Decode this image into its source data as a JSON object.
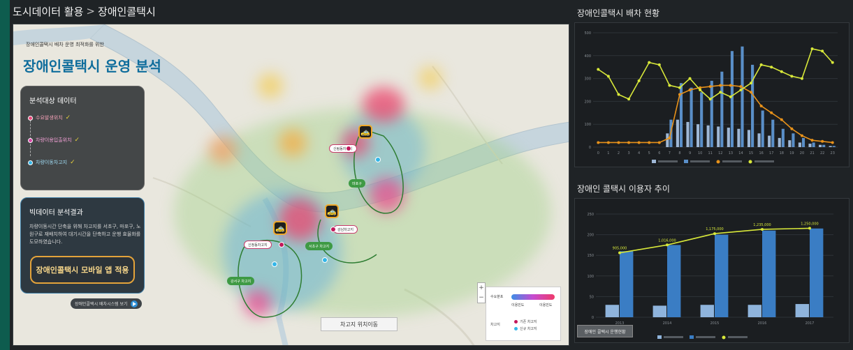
{
  "breadcrumb": {
    "parent": "도시데이터 활용",
    "separator": ">",
    "current": "장애인콜택시"
  },
  "intro": {
    "subtitle": "장애인콜택시 배차 운영 최적화를 위한",
    "title": "장애인콜택시 운영 분석"
  },
  "analysis_panel": {
    "title": "분석대상 데이터",
    "items": [
      {
        "label": "수요발생위치",
        "color": "#e84a7a"
      },
      {
        "label": "차량이용입출위치",
        "color": "#d946a8"
      },
      {
        "label": "차량이동차고지",
        "color": "#33b6e8"
      }
    ],
    "check_mark": "✓"
  },
  "result_panel": {
    "title": "빅데이터 분석결과",
    "body": "차량이동시간 단축을 위해 차고지를 서초구, 마포구, 노원구로 재배치하여 대기시간을 단축하고 운행 효율화를 도모하였습니다."
  },
  "app_button": "장애인콜택시 모바일 앱 적용",
  "play_button": "장애인콜택시 배차시스템 보기",
  "map": {
    "pins": [
      {
        "label": "신림동차고지"
      },
      {
        "label": "강남차고지"
      },
      {
        "label": "신정동차고지"
      }
    ],
    "green_tags": [
      "마포구",
      "서초구 차고지",
      "강서구 차고지"
    ],
    "legend": {
      "title": "수요분포",
      "low": "이용빈도",
      "high": "이용빈도",
      "sub_title": "차고지",
      "items": [
        "기존 차고지",
        "신규 차고지"
      ]
    },
    "garage_button": "차고지 위치이동",
    "zoom_in": "+",
    "zoom_out": "−"
  },
  "dispatch_chart": {
    "title": "장애인콜택시 배차 현황",
    "chart_data": {
      "type": "bar",
      "categories": [
        "0",
        "1",
        "2",
        "3",
        "4",
        "5",
        "6",
        "7",
        "8",
        "9",
        "10",
        "11",
        "12",
        "13",
        "14",
        "15",
        "16",
        "17",
        "18",
        "19",
        "20",
        "21",
        "22",
        "23"
      ],
      "series": [
        {
          "name": "",
          "kind": "bar",
          "color": "#9fb8d6",
          "values": [
            0,
            0,
            0,
            0,
            0,
            0,
            0,
            60,
            120,
            110,
            100,
            95,
            90,
            85,
            80,
            75,
            60,
            50,
            40,
            30,
            20,
            15,
            10,
            5
          ]
        },
        {
          "name": "",
          "kind": "bar",
          "color": "#5a8fc8",
          "values": [
            0,
            0,
            0,
            0,
            0,
            0,
            0,
            120,
            280,
            260,
            240,
            290,
            330,
            420,
            440,
            360,
            160,
            120,
            80,
            60,
            40,
            20,
            10,
            5
          ]
        },
        {
          "name": "",
          "kind": "line",
          "color": "#e8921a",
          "values": [
            20,
            20,
            20,
            20,
            20,
            20,
            20,
            40,
            230,
            250,
            260,
            265,
            270,
            270,
            265,
            240,
            180,
            150,
            120,
            80,
            50,
            30,
            25,
            20
          ]
        },
        {
          "name": "",
          "kind": "line",
          "color": "#d8e83a",
          "values": [
            340,
            310,
            230,
            210,
            290,
            370,
            360,
            270,
            260,
            300,
            250,
            210,
            240,
            220,
            250,
            280,
            360,
            350,
            330,
            310,
            300,
            430,
            420,
            370
          ]
        }
      ],
      "ylim": [
        0,
        500
      ],
      "legend_position": "bottom"
    }
  },
  "users_chart": {
    "title": "장애인 콜택시 이용자 추이",
    "button": "장애인 콜택시 운행현황",
    "chart_data": {
      "type": "bar",
      "categories": [
        "2013",
        "2014",
        "2015",
        "2016",
        "2017"
      ],
      "series": [
        {
          "name": "",
          "kind": "bar",
          "color": "#8fb4dc",
          "values": [
            30,
            28,
            30,
            30,
            32
          ]
        },
        {
          "name": "",
          "kind": "bar",
          "color": "#3a7dc4",
          "values": [
            160,
            175,
            200,
            210,
            215
          ]
        },
        {
          "name": "",
          "kind": "line",
          "color": "#d8e83a",
          "values": [
            905000,
            1016000,
            1175000,
            1235000,
            1250000
          ]
        }
      ],
      "ylim": [
        0,
        250
      ],
      "legend_position": "bottom"
    }
  }
}
